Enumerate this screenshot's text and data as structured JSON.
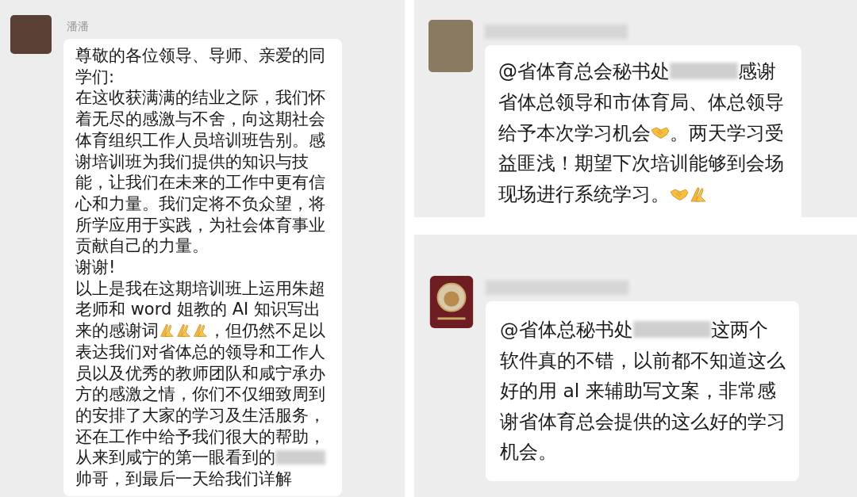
{
  "chats": [
    {
      "sender": {
        "kind": "name",
        "text": "潘潘"
      },
      "avatar": {
        "kind": "photo"
      },
      "paragraphs": [
        [
          {
            "kind": "text",
            "text": "尊敬的各位领导、导师、亲爱的同学们:"
          }
        ],
        [
          {
            "kind": "text",
            "text": "在这收获满满的结业之际，我们怀着无尽的感激与不舍，向这期社会体育组织工作人员培训班告别。感谢培训班为我们提供的知识与技能，让我们在未来的工作中更有信心和力量。我们定将不负众望，将所学应用于实践，为社会体育事业贡献自己的力量。"
          }
        ],
        [
          {
            "kind": "text",
            "text": "谢谢!"
          }
        ],
        [
          {
            "kind": "text",
            "text": "以上是我在这期培训班上运用朱超老师和 word 姐教的 AI 知识写出来的感谢词"
          },
          {
            "kind": "pray-emoji"
          },
          {
            "kind": "pray-emoji"
          },
          {
            "kind": "pray-emoji"
          },
          {
            "kind": "text",
            "text": "，但仍然不足以表达我们对省体总的领导和工作人员以及优秀的教师团队和咸宁承办方的感激之情，你们不仅细致周到的安排了大家的学习及生活服务，还在工作中给予我们很大的帮助，从来到咸宁的第一眼看到的"
          },
          {
            "kind": "redaction"
          },
          {
            "kind": "text",
            "text": "帅哥，到最后一天给我们详解"
          }
        ]
      ]
    },
    {
      "sender": {
        "kind": "redacted"
      },
      "avatar": {
        "kind": "photo"
      },
      "paragraphs": [
        [
          {
            "kind": "text",
            "text": "@省体育总会秘书处"
          },
          {
            "kind": "redaction"
          },
          {
            "kind": "text",
            "text": "感谢省体总领导和市体育局、体总领导给予本次学习机会"
          },
          {
            "kind": "handshake-emoji"
          },
          {
            "kind": "text",
            "text": "。两天学习受益匪浅！期望下次培训能够到会场现场进行系统学习。"
          },
          {
            "kind": "handshake-emoji"
          },
          {
            "kind": "pray-emoji"
          }
        ]
      ]
    },
    {
      "sender": {
        "kind": "redacted"
      },
      "avatar": {
        "kind": "logo"
      },
      "paragraphs": [
        [
          {
            "kind": "text",
            "text": "@省体总秘书处"
          },
          {
            "kind": "redaction"
          },
          {
            "kind": "text",
            "text": "这两个软件真的不错，以前都不知道这么好的用 al 来辅助写文案，非常感谢省体育总会提供的这么好的学习机会。"
          }
        ]
      ]
    }
  ]
}
